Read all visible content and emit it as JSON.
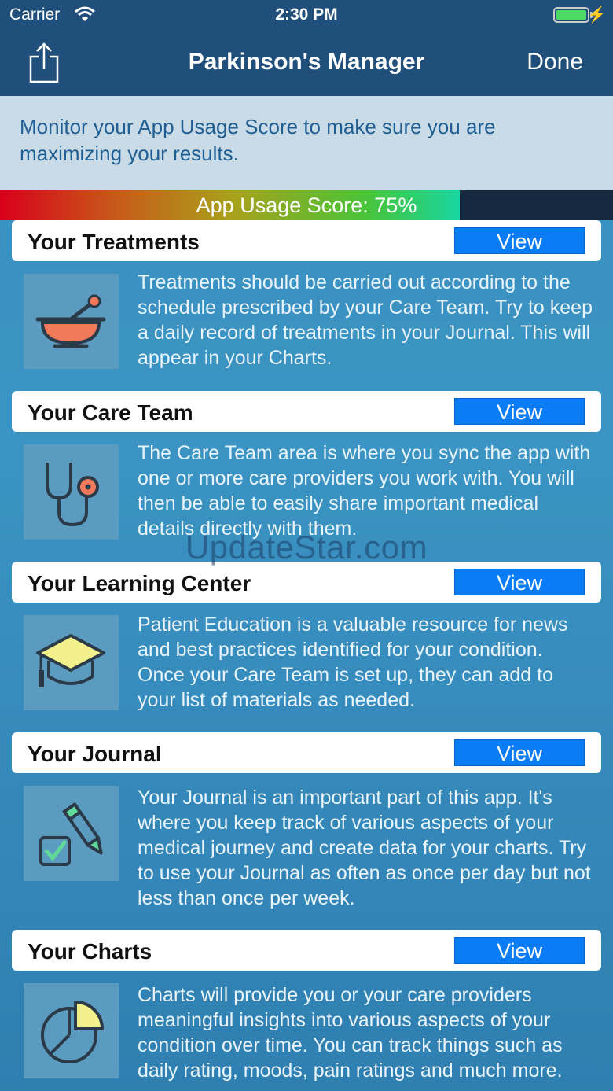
{
  "status": {
    "carrier": "Carrier",
    "time": "2:30 PM",
    "battery_level": 1.0
  },
  "nav": {
    "title": "Parkinson's Manager",
    "done_label": "Done"
  },
  "banner": {
    "text": "Monitor your App Usage Score to make sure you are maximizing your results."
  },
  "score": {
    "label": "App Usage Score: 75%",
    "percent": 75
  },
  "sections": [
    {
      "title": "Your Treatments",
      "view_label": "View",
      "icon": "mortar-pestle-icon",
      "description": "Treatments should be carried out according to the schedule prescribed by your Care Team. Try to keep a daily record of treatments in your Journal. This will appear in your Charts."
    },
    {
      "title": "Your Care Team",
      "view_label": "View",
      "icon": "stethoscope-icon",
      "description": "The Care Team area is where you sync the app with one or more care providers you work with. You will then be able to easily share important medical details directly with them."
    },
    {
      "title": "Your Learning Center",
      "view_label": "View",
      "icon": "graduation-cap-icon",
      "description": "Patient Education is a valuable resource for news and best practices identified for your condition. Once your Care Team is set up, they can add to your list of materials as needed."
    },
    {
      "title": "Your Journal",
      "view_label": "View",
      "icon": "journal-pencil-checkbox-icon",
      "description": "Your Journal is an important part of this app. It's where you keep track of various aspects of your medical journey and create data for your charts. Try to use your Journal as often as once per day but not less than once per week."
    },
    {
      "title": "Your Charts",
      "view_label": "View",
      "icon": "pie-chart-icon",
      "description": "Charts will provide you or your care providers meaningful insights into various aspects of your condition over time. You can track things such as daily rating, moods, pain ratings and much more."
    }
  ],
  "watermark": "UpdateStar.com",
  "colors": {
    "nav_bg": "#1f4f7a",
    "accent": "#0a7cf5",
    "banner_text": "#1f5e93",
    "icon_orange": "#f07a5a",
    "icon_yellow": "#f2f08a",
    "icon_green": "#5fd89a"
  }
}
